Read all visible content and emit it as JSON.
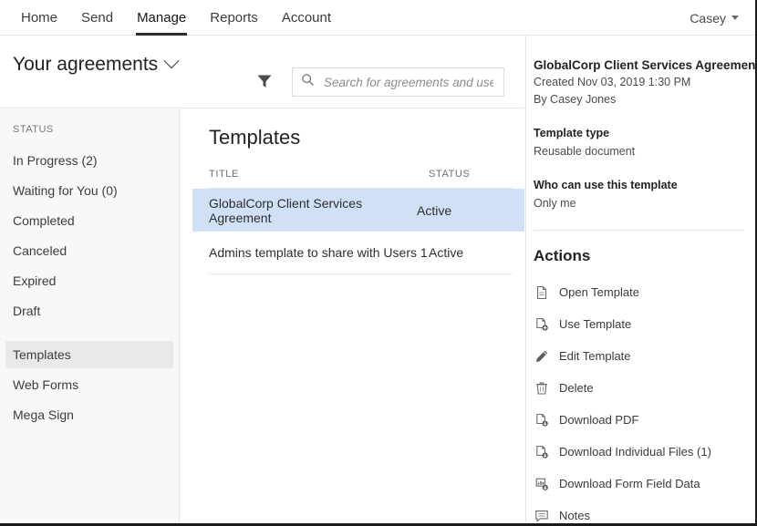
{
  "topbar": {
    "nav": [
      {
        "label": "Home",
        "active": false
      },
      {
        "label": "Send",
        "active": false
      },
      {
        "label": "Manage",
        "active": true
      },
      {
        "label": "Reports",
        "active": false
      },
      {
        "label": "Account",
        "active": false
      }
    ],
    "user": "Casey"
  },
  "header": {
    "page_title": "Your agreements",
    "filter_icon": "filter-icon",
    "search": {
      "icon": "search-icon",
      "value": "",
      "placeholder": "Search for agreements and users..."
    }
  },
  "sidebar": {
    "heading": "STATUS",
    "items": [
      {
        "label": "In Progress (2)",
        "selected": false
      },
      {
        "label": "Waiting for You (0)",
        "selected": false
      },
      {
        "label": "Completed",
        "selected": false
      },
      {
        "label": "Canceled",
        "selected": false
      },
      {
        "label": "Expired",
        "selected": false
      },
      {
        "label": "Draft",
        "selected": false
      }
    ],
    "items2": [
      {
        "label": "Templates",
        "selected": true
      },
      {
        "label": "Web Forms",
        "selected": false
      },
      {
        "label": "Mega Sign",
        "selected": false
      }
    ]
  },
  "main": {
    "title": "Templates",
    "columns": {
      "title": "TITLE",
      "status": "STATUS"
    },
    "rows": [
      {
        "title": "GlobalCorp Client Services Agreement",
        "status": "Active",
        "selected": true
      },
      {
        "title": "Admins template to share with Users 1",
        "status": "Active",
        "selected": false
      }
    ]
  },
  "detail": {
    "title": "GlobalCorp Client Services Agreement",
    "created": "Created Nov 03, 2019 1:30 PM",
    "by": "By Casey Jones",
    "type_label": "Template type",
    "type_value": "Reusable document",
    "who_label": "Who can use this template",
    "who_value": "Only me",
    "actions_title": "Actions",
    "actions": [
      {
        "label": "Open Template",
        "icon": "document-icon"
      },
      {
        "label": "Use Template",
        "icon": "document-plus-icon"
      },
      {
        "label": "Edit Template",
        "icon": "pencil-icon"
      },
      {
        "label": "Delete",
        "icon": "trash-icon"
      },
      {
        "label": "Download PDF",
        "icon": "download-pdf-icon"
      },
      {
        "label": "Download Individual Files (1)",
        "icon": "download-files-icon"
      },
      {
        "label": "Download Form Field Data",
        "icon": "download-data-icon"
      },
      {
        "label": "Notes",
        "icon": "notes-icon"
      }
    ]
  },
  "colors": {
    "selected_row": "#cfe0f7",
    "sidebar_bg": "#f8f8f8",
    "sidebar_selected": "#e9e9e9",
    "text": "#3c3c3c"
  }
}
